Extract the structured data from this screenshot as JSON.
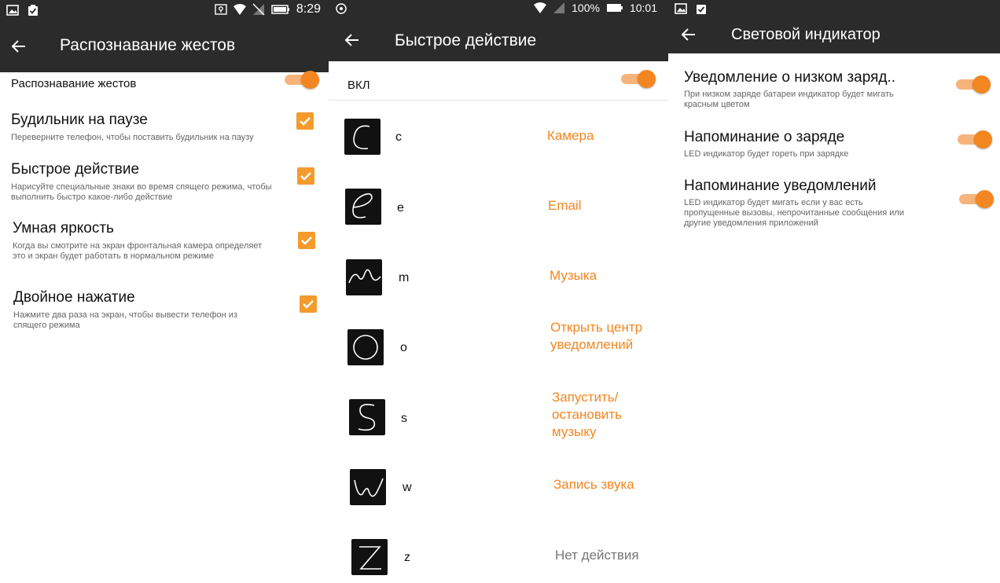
{
  "panel1": {
    "status": {
      "time": "8:29"
    },
    "title": "Распознавание жестов",
    "toggle_row": {
      "label": "Распознавание жестов",
      "on": true
    },
    "items": [
      {
        "title": "Будильник на паузе",
        "subtitle": "Переверните телефон, чтобы поставить будильник на паузу",
        "checked": true
      },
      {
        "title": "Быстрое действие",
        "subtitle": "Нарисуйте специальные знаки во время спящего режима, чтобы выполнить быстро какое-либо действие",
        "checked": true
      },
      {
        "title": "Умная яркость",
        "subtitle": "Когда вы смотрите на экран фронтальная камера определяет это и экран будет работать в нормальном режиме",
        "checked": true
      },
      {
        "title": "Двойное нажатие",
        "subtitle": "Нажмите два раза на экран, чтобы вывести телефон из спящего режима",
        "checked": true
      }
    ]
  },
  "panel2": {
    "status": {
      "battery": "100%",
      "time": "10:01"
    },
    "title": "Быстрое действие",
    "toggle_row": {
      "label": "ВКЛ",
      "on": true
    },
    "gestures": [
      {
        "letter": "c",
        "action": "Камера",
        "icon": "gesture-c-icon"
      },
      {
        "letter": "e",
        "action": "Email",
        "icon": "gesture-e-icon"
      },
      {
        "letter": "m",
        "action": "Музыка",
        "icon": "gesture-m-icon"
      },
      {
        "letter": "o",
        "action": "Открыть центр уведомлений",
        "icon": "gesture-o-icon"
      },
      {
        "letter": "s",
        "action": "Запустить/ остановить музыку",
        "icon": "gesture-s-icon"
      },
      {
        "letter": "w",
        "action": "Запись звука",
        "icon": "gesture-w-icon"
      },
      {
        "letter": "z",
        "action": "Нет действия",
        "icon": "gesture-z-icon"
      }
    ]
  },
  "panel3": {
    "title": "Световой индикатор",
    "items": [
      {
        "title": "Уведомление о низком заряд..",
        "subtitle": "При низком заряде батареи индикатор будет мигать красным цветом",
        "on": true
      },
      {
        "title": "Напоминание о заряде",
        "subtitle": "LED индикатор будет гореть при зарядке",
        "on": true
      },
      {
        "title": "Напоминание уведомлений",
        "subtitle": "LED индикатор будет мигать если у вас есть пропущенные вызовы, непрочитанные сообщения или другие уведомления приложений",
        "on": true
      }
    ]
  },
  "colors": {
    "accent": "#f38620",
    "toolbar": "#2b2b2b",
    "track": "#f6b47a"
  }
}
